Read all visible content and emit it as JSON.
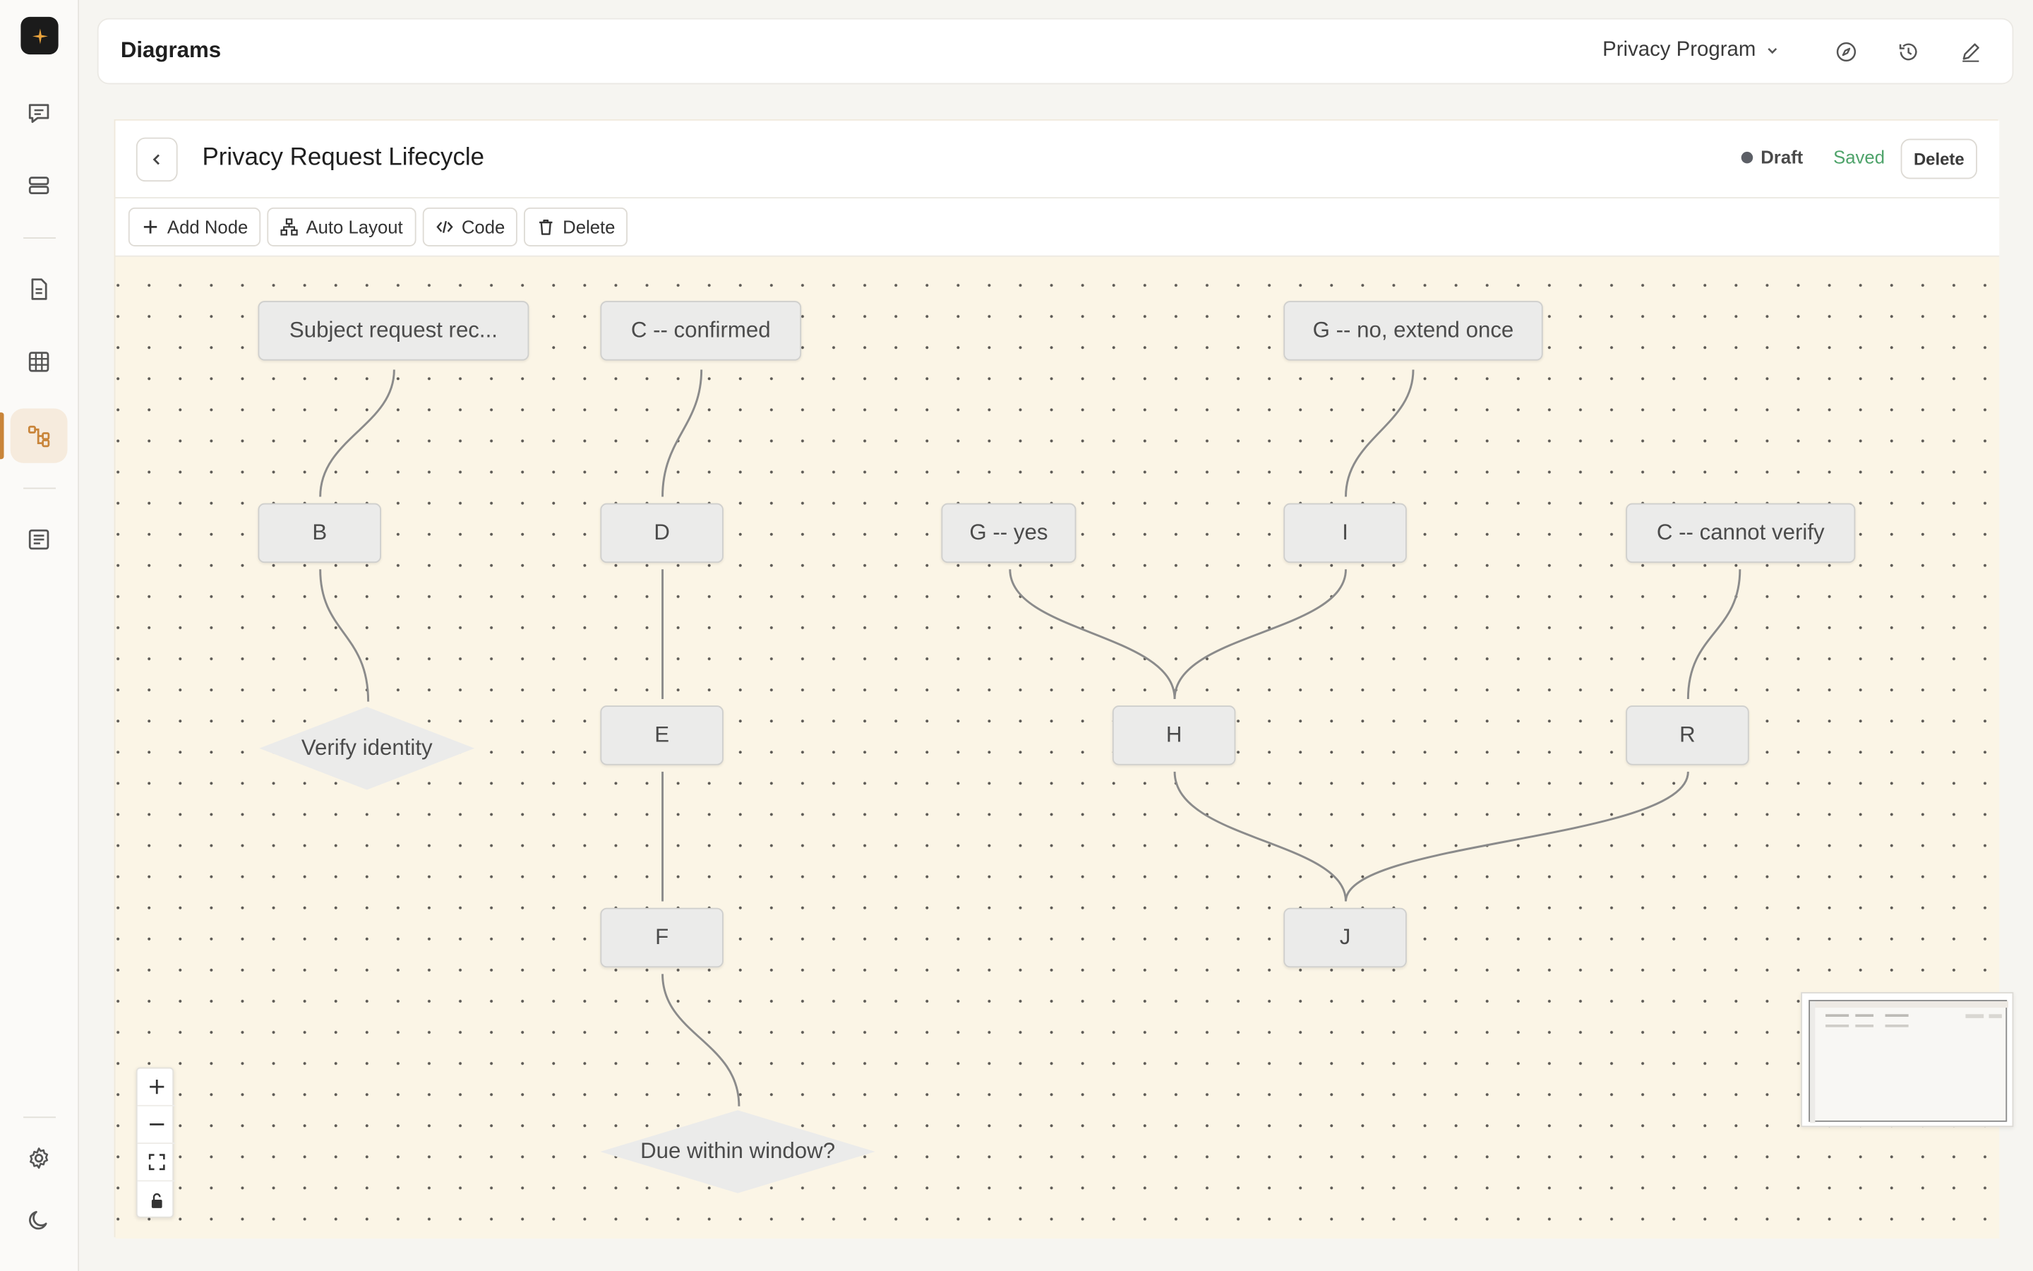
{
  "app": {
    "section_title": "Diagrams",
    "project_selector": "Privacy Program"
  },
  "document": {
    "title": "Privacy Request Lifecycle",
    "status": "Draft",
    "save_state": "Saved",
    "delete_label": "Delete"
  },
  "toolbar": {
    "add_node": "Add Node",
    "auto_layout": "Auto Layout",
    "code": "Code",
    "delete": "Delete"
  },
  "nodes": {
    "subject_request": "Subject request rec...",
    "c_confirmed": "C -- confirmed",
    "g_no_extend": "G -- no, extend once",
    "b": "B",
    "d": "D",
    "g_yes": "G -- yes",
    "i": "I",
    "c_cannot_verify": "C -- cannot verify",
    "verify_identity": "Verify identity",
    "e": "E",
    "h": "H",
    "r": "R",
    "f": "F",
    "j": "J",
    "due_within_window": "Due within window?"
  },
  "colors": {
    "accent": "#c9853a",
    "canvas_bg": "#fbf5e6",
    "saved_green": "#4ea36a",
    "node_fill": "#ebebea"
  },
  "icons": {
    "sidebar": [
      "chat-icon",
      "database-icon",
      "document-icon",
      "table-icon",
      "diagram-icon",
      "notes-icon",
      "settings-icon",
      "moon-icon"
    ],
    "topbar": [
      "compass-icon",
      "history-icon",
      "edit-icon"
    ]
  }
}
